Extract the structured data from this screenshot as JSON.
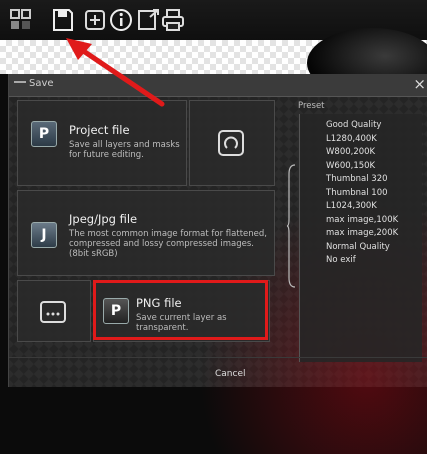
{
  "toolbar": {
    "icons": [
      "layers-icon",
      "save-icon",
      "add-layer-icon",
      "info-icon",
      "export-icon",
      "print-icon"
    ]
  },
  "dialog": {
    "title": "Save",
    "close": "×",
    "cancel": "Cancel",
    "preset_label": "Preset",
    "options": {
      "project": {
        "title": "Project file",
        "desc": "Save all layers and masks for future editing."
      },
      "jpeg": {
        "title": "Jpeg/Jpg file",
        "desc": "The most common image format for flattened, compressed and lossy compressed images. (8bit sRGB)"
      },
      "png": {
        "title": "PNG file",
        "desc": "Save current layer as transparent."
      }
    },
    "presets": [
      "Good Quality",
      "L1280,400K",
      "W800,200K",
      "W600,150K",
      "Thumbnal 320",
      "Thumbnal 100",
      "L1024,300K",
      "max image,100K",
      "max image,200K",
      "Normal Quality",
      "No exif"
    ]
  },
  "accent": {
    "highlight": "#e01a1a",
    "arrow": "#e01a1a"
  }
}
